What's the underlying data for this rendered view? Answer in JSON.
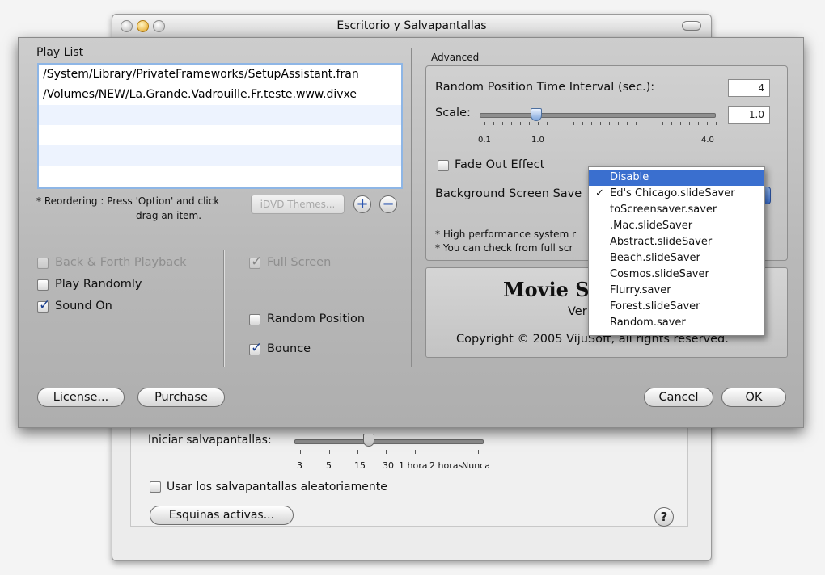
{
  "background_window": {
    "title": "Escritorio y Salvapantallas",
    "start_label": "Iniciar salvapantallas:",
    "slider_ticks": [
      "3",
      "5",
      "15",
      "30",
      "1 hora",
      "2 horas",
      "Nunca"
    ],
    "random_checkbox": "Usar los salvapantallas aleatoriamente",
    "hot_corners_button": "Esquinas activas...",
    "help_symbol": "?"
  },
  "sheet": {
    "playlist_label": "Play List",
    "playlist_items": [
      "/System/Library/PrivateFrameworks/SetupAssistant.fran",
      "/Volumes/NEW/La.Grande.Vadrouille.Fr.teste.www.divxe"
    ],
    "reorder_hint_line1": "* Reordering : Press 'Option' and click",
    "reorder_hint_line2": "drag an item.",
    "idvd_button": "iDVD Themes...",
    "add_symbol": "+",
    "remove_symbol": "−",
    "options_left": [
      {
        "label": "Back & Forth Playback",
        "checked": false,
        "enabled": false
      },
      {
        "label": "Play Randomly",
        "checked": false,
        "enabled": true
      },
      {
        "label": "Sound On",
        "checked": true,
        "enabled": true
      }
    ],
    "options_right": [
      {
        "label": "Full Screen",
        "checked": true,
        "enabled": false
      },
      {
        "label": "Random Position",
        "checked": false,
        "enabled": true
      },
      {
        "label": "Bounce",
        "checked": true,
        "enabled": true
      }
    ],
    "advanced": {
      "label": "Advanced",
      "interval_label": "Random Position Time Interval (sec.):",
      "interval_value": "4",
      "scale_label": "Scale:",
      "scale_value": "1.0",
      "scale_min": "0.1",
      "scale_mid": "1.0",
      "scale_max": "4.0",
      "fade_label": "Fade Out Effect",
      "fade_checked": false,
      "bg_label": "Background Screen Save",
      "note1": "* High performance system r",
      "note2": "* You can check from full scr"
    },
    "about": {
      "title": "Movie Sc",
      "version": "Ver",
      "copyright": "Copyright © 2005 VijuSoft, all rights reserved."
    },
    "buttons": {
      "license": "License...",
      "purchase": "Purchase",
      "cancel": "Cancel",
      "ok": "OK"
    }
  },
  "popup_menu": {
    "items": [
      "Disable",
      "Ed's Chicago.slideSaver",
      "toScreensaver.saver",
      ".Mac.slideSaver",
      "Abstract.slideSaver",
      "Beach.slideSaver",
      "Cosmos.slideSaver",
      "Flurry.saver",
      "Forest.slideSaver",
      "Random.saver"
    ],
    "highlighted": "Disable",
    "checked": "Ed's Chicago.slideSaver",
    "check_symbol": "✓"
  },
  "colors": {
    "highlight": "#3a6fcf",
    "playlist_border": "#8eb6e6"
  }
}
